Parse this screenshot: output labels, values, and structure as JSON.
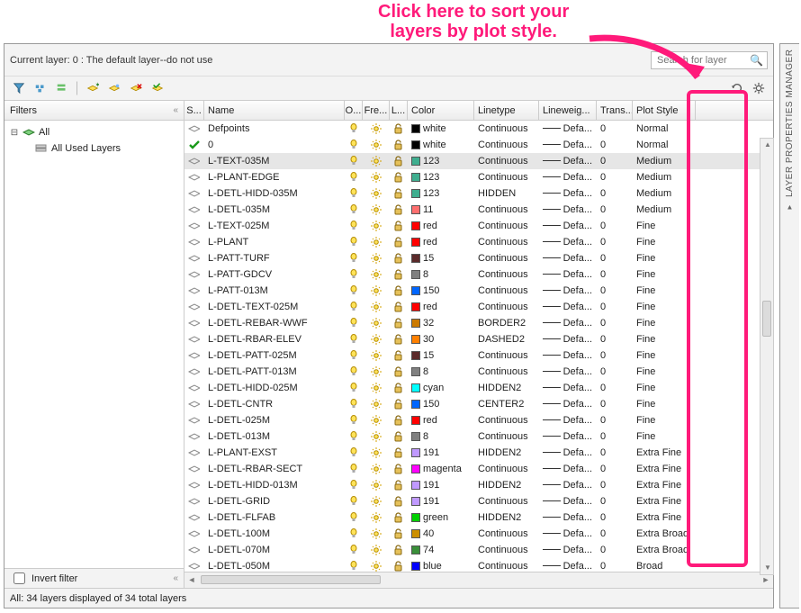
{
  "annotation": {
    "line1": "Click here to sort your",
    "line2": "layers by plot style."
  },
  "side_title": "LAYER PROPERTIES MANAGER",
  "current_layer": "Current layer: 0 : The default layer--do not use",
  "search_placeholder": "Search for layer",
  "filters": {
    "title": "Filters",
    "tree": {
      "root": "All",
      "child": "All Used Layers"
    },
    "invert": "Invert filter"
  },
  "columns": {
    "status": "S...",
    "name": "Name",
    "on": "O...",
    "freeze": "Fre...",
    "lock": "L...",
    "color": "Color",
    "linetype": "Linetype",
    "lineweight": "Lineweig...",
    "trans": "Trans...",
    "pstyle": "Plot Style"
  },
  "lw_default": "Defa...",
  "rows": [
    {
      "name": "Defpoints",
      "color_name": "white",
      "swatch": "#000000",
      "linetype": "Continuous",
      "trans": "0",
      "pstyle": "Normal"
    },
    {
      "name": "0",
      "status": "current",
      "color_name": "white",
      "swatch": "#000000",
      "linetype": "Continuous",
      "trans": "0",
      "pstyle": "Normal"
    },
    {
      "name": "L-TEXT-035M",
      "selected": true,
      "color_name": "123",
      "swatch": "#3fae8f",
      "linetype": "Continuous",
      "trans": "0",
      "pstyle": "Medium"
    },
    {
      "name": "L-PLANT-EDGE",
      "color_name": "123",
      "swatch": "#3fae8f",
      "linetype": "Continuous",
      "trans": "0",
      "pstyle": "Medium"
    },
    {
      "name": "L-DETL-HIDD-035M",
      "color_name": "123",
      "swatch": "#3fae8f",
      "linetype": "HIDDEN",
      "trans": "0",
      "pstyle": "Medium"
    },
    {
      "name": "L-DETL-035M",
      "color_name": "11",
      "swatch": "#ff6f6f",
      "linetype": "Continuous",
      "trans": "0",
      "pstyle": "Medium"
    },
    {
      "name": "L-TEXT-025M",
      "color_name": "red",
      "swatch": "#ff0000",
      "linetype": "Continuous",
      "trans": "0",
      "pstyle": "Fine"
    },
    {
      "name": "L-PLANT",
      "color_name": "red",
      "swatch": "#ff0000",
      "linetype": "Continuous",
      "trans": "0",
      "pstyle": "Fine"
    },
    {
      "name": "L-PATT-TURF",
      "color_name": "15",
      "swatch": "#5b2a2a",
      "linetype": "Continuous",
      "trans": "0",
      "pstyle": "Fine"
    },
    {
      "name": "L-PATT-GDCV",
      "color_name": "8",
      "swatch": "#808080",
      "linetype": "Continuous",
      "trans": "0",
      "pstyle": "Fine"
    },
    {
      "name": "L-PATT-013M",
      "color_name": "150",
      "swatch": "#0066ff",
      "linetype": "Continuous",
      "trans": "0",
      "pstyle": "Fine"
    },
    {
      "name": "L-DETL-TEXT-025M",
      "color_name": "red",
      "swatch": "#ff0000",
      "linetype": "Continuous",
      "trans": "0",
      "pstyle": "Fine"
    },
    {
      "name": "L-DETL-REBAR-WWF",
      "color_name": "32",
      "swatch": "#cc7a00",
      "linetype": "BORDER2",
      "trans": "0",
      "pstyle": "Fine"
    },
    {
      "name": "L-DETL-RBAR-ELEV",
      "color_name": "30",
      "swatch": "#ff8000",
      "linetype": "DASHED2",
      "trans": "0",
      "pstyle": "Fine"
    },
    {
      "name": "L-DETL-PATT-025M",
      "color_name": "15",
      "swatch": "#5b2a2a",
      "linetype": "Continuous",
      "trans": "0",
      "pstyle": "Fine"
    },
    {
      "name": "L-DETL-PATT-013M",
      "color_name": "8",
      "swatch": "#808080",
      "linetype": "Continuous",
      "trans": "0",
      "pstyle": "Fine"
    },
    {
      "name": "L-DETL-HIDD-025M",
      "color_name": "cyan",
      "swatch": "#00ffff",
      "linetype": "HIDDEN2",
      "trans": "0",
      "pstyle": "Fine"
    },
    {
      "name": "L-DETL-CNTR",
      "color_name": "150",
      "swatch": "#0066ff",
      "linetype": "CENTER2",
      "trans": "0",
      "pstyle": "Fine"
    },
    {
      "name": "L-DETL-025M",
      "color_name": "red",
      "swatch": "#ff0000",
      "linetype": "Continuous",
      "trans": "0",
      "pstyle": "Fine"
    },
    {
      "name": "L-DETL-013M",
      "color_name": "8",
      "swatch": "#808080",
      "linetype": "Continuous",
      "trans": "0",
      "pstyle": "Fine"
    },
    {
      "name": "L-PLANT-EXST",
      "color_name": "191",
      "swatch": "#c099ff",
      "linetype": "HIDDEN2",
      "trans": "0",
      "pstyle": "Extra Fine"
    },
    {
      "name": "L-DETL-RBAR-SECT",
      "color_name": "magenta",
      "swatch": "#ff00ff",
      "linetype": "Continuous",
      "trans": "0",
      "pstyle": "Extra Fine"
    },
    {
      "name": "L-DETL-HIDD-013M",
      "color_name": "191",
      "swatch": "#c099ff",
      "linetype": "HIDDEN2",
      "trans": "0",
      "pstyle": "Extra Fine"
    },
    {
      "name": "L-DETL-GRID",
      "color_name": "191",
      "swatch": "#c099ff",
      "linetype": "Continuous",
      "trans": "0",
      "pstyle": "Extra Fine"
    },
    {
      "name": "L-DETL-FLFAB",
      "color_name": "green",
      "swatch": "#00d000",
      "linetype": "HIDDEN2",
      "trans": "0",
      "pstyle": "Extra Fine"
    },
    {
      "name": "L-DETL-100M",
      "color_name": "40",
      "swatch": "#cc8f00",
      "linetype": "Continuous",
      "trans": "0",
      "pstyle": "Extra Broad"
    },
    {
      "name": "L-DETL-070M",
      "color_name": "74",
      "swatch": "#3a8f3a",
      "linetype": "Continuous",
      "trans": "0",
      "pstyle": "Extra Broad"
    },
    {
      "name": "L-DETL-050M",
      "color_name": "blue",
      "swatch": "#0000ff",
      "linetype": "Continuous",
      "trans": "0",
      "pstyle": "Broad"
    }
  ],
  "status_line": "All: 34 layers displayed of 34 total layers"
}
